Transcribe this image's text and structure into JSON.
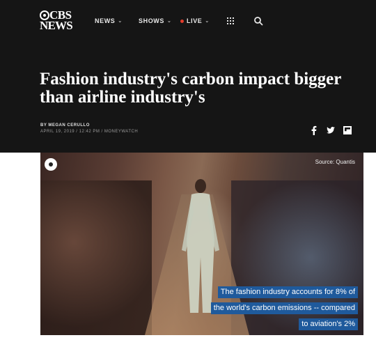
{
  "header": {
    "logo": {
      "line1": "CBS",
      "line2": "NEWS"
    },
    "nav": {
      "news": "NEWS",
      "shows": "SHOWS",
      "live": "LIVE"
    },
    "icons": {
      "grid": "grid-icon",
      "search": "search-icon"
    }
  },
  "article": {
    "title": "Fashion industry's carbon impact bigger than airline industry's",
    "byline": "BY MEGAN CERULLO",
    "dateline": "APRIL 19, 2019 / 12:42 PM / MONEYWATCH",
    "share_icons": [
      "facebook-icon",
      "twitter-icon",
      "flipboard-icon"
    ]
  },
  "video": {
    "source": "Source: Quantis",
    "caption": [
      "The fashion industry accounts for 8% of",
      "the world's carbon emissions -- compared",
      "to aviation's 2%"
    ],
    "caption_bg": "#1f5a9c"
  },
  "colors": {
    "header_bg": "#151515",
    "live_dot": "#e23c2c"
  }
}
